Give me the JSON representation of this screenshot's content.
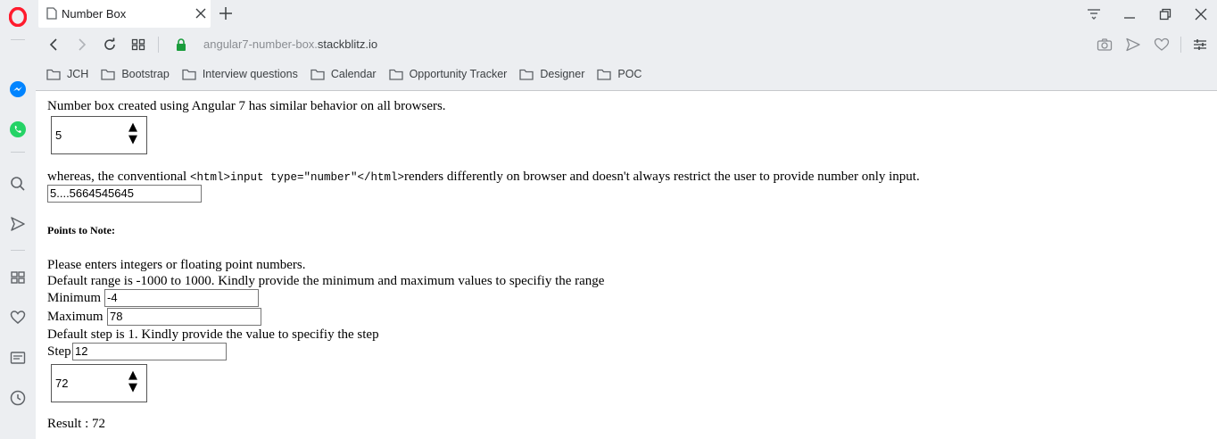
{
  "browser": {
    "tab": {
      "title": "Number Box"
    },
    "address": {
      "prefix": "angular7-number-box.",
      "host": "stackblitz.io"
    },
    "bookmarks": [
      "JCH",
      "Bootstrap",
      "Interview questions",
      "Calendar",
      "Opportunity Tracker",
      "Designer",
      "POC"
    ],
    "icons": {
      "sidebar": [
        "opera-logo-icon",
        "messenger-icon",
        "whatsapp-icon",
        "search-icon",
        "send-icon",
        "speed-dial-icon",
        "heart-icon",
        "news-icon",
        "history-icon"
      ],
      "nav": [
        "back-icon",
        "forward-icon",
        "reload-icon",
        "tabs-grid-icon",
        "lock-icon",
        "camera-icon",
        "send-icon",
        "heart-icon",
        "easy-setup-icon"
      ]
    },
    "colors": {
      "opera_red": "#ff1b2d",
      "messenger_blue": "#0084ff",
      "whatsapp_green": "#25d366",
      "lock_green": "#1a9c3c"
    }
  },
  "page": {
    "intro": "Number box created using Angular 7 has similar behavior on all browsers.",
    "numbox1_value": "5",
    "spinner_up": "▲",
    "spinner_down": "▼",
    "conventional_text_before": "whereas, the conventional ",
    "conventional_code": "<html>input type=\"number\"</html>",
    "conventional_text_after": "renders differently on browser and doesn't always restrict the user to provide number only input.",
    "conventional_input_value": "5....5664545645",
    "points_heading": "Points to Note:",
    "note_integers": "Please enters integers or floating point numbers.",
    "note_range": "Default range is -1000 to 1000. Kindly provide the minimum and maximum values to specifiy the range",
    "minimum_label": "Minimum",
    "minimum_value": "-4",
    "maximum_label": "Maximum",
    "maximum_value": "78",
    "note_step": "Default step is 1. Kindly provide the value to specifiy the step",
    "step_label": "Step",
    "step_value": "12",
    "numbox2_value": "72",
    "result_text": "Result : 72"
  }
}
